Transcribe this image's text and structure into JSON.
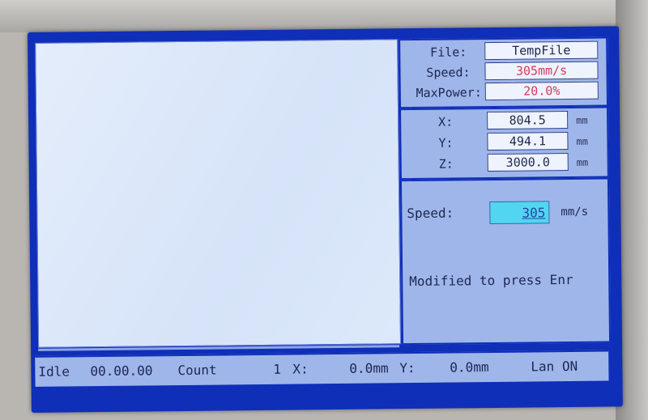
{
  "info": {
    "file_label": "File:",
    "file_value": "TempFile",
    "speed_label": "Speed:",
    "speed_value": "305mm/s",
    "maxpower_label": "MaxPower:",
    "maxpower_value": "20.0%"
  },
  "coords": {
    "x_label": "X:",
    "x_value": "804.5",
    "x_unit": "mm",
    "y_label": "Y:",
    "y_value": "494.1",
    "y_unit": "mm",
    "z_label": "Z:",
    "z_value": "3000.0",
    "z_unit": "mm"
  },
  "edit": {
    "speed_label": "Speed:",
    "speed_input": "305",
    "speed_unit": "mm/s",
    "hint": "Modified to press Enr"
  },
  "status": {
    "state": "Idle",
    "time": "00.00.00",
    "count_label": "Count",
    "count_value": "1",
    "x_label": "X:",
    "x_value": "0.0mm",
    "y_label": "Y:",
    "y_value": "0.0mm",
    "lan": "Lan ON"
  },
  "colors": {
    "frame": "#0f2fb8",
    "panel": "#9fb6ea",
    "canvas": "#dbe7fb",
    "input_highlight": "#52d5f1",
    "value_red": "#d43b57"
  }
}
